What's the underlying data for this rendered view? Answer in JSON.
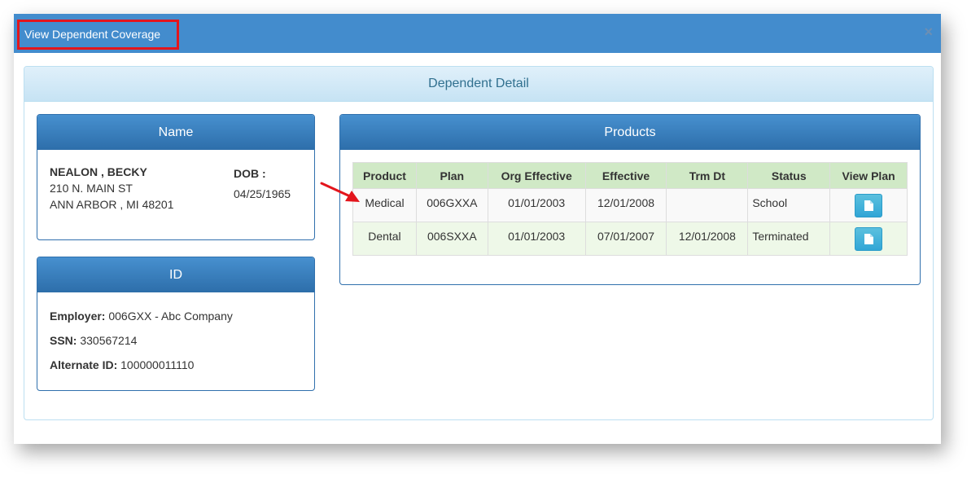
{
  "modal": {
    "title": "View Dependent Coverage",
    "close_symbol": "×"
  },
  "detail": {
    "heading": "Dependent Detail"
  },
  "name_panel": {
    "heading": "Name",
    "name": "NEALON , BECKY",
    "address1": "210 N. MAIN ST",
    "address2": "ANN ARBOR , MI 48201",
    "dob_label": "DOB :",
    "dob_value": "04/25/1965"
  },
  "id_panel": {
    "heading": "ID",
    "employer_label": "Employer:",
    "employer_value": "006GXX - Abc Company",
    "ssn_label": "SSN:",
    "ssn_value": "330567214",
    "alt_label": "Alternate ID:",
    "alt_value": "100000011110"
  },
  "products_panel": {
    "heading": "Products",
    "columns": [
      "Product",
      "Plan",
      "Org Effective",
      "Effective",
      "Trm Dt",
      "Status",
      "View Plan"
    ],
    "rows": [
      {
        "product": "Medical",
        "plan": "006GXXA",
        "org_effective": "01/01/2003",
        "effective": "12/01/2008",
        "trm_dt": "",
        "status": "School"
      },
      {
        "product": "Dental",
        "plan": "006SXXA",
        "org_effective": "01/01/2003",
        "effective": "07/01/2007",
        "trm_dt": "12/01/2008",
        "status": "Terminated"
      }
    ],
    "view_plan_icon": "document-icon"
  },
  "colors": {
    "header_bg": "#438ccd",
    "panel_head": "#2d6eaa",
    "table_head": "#d0e9c6",
    "highlight_border": "#e3151c",
    "button": "#5bc0de"
  }
}
